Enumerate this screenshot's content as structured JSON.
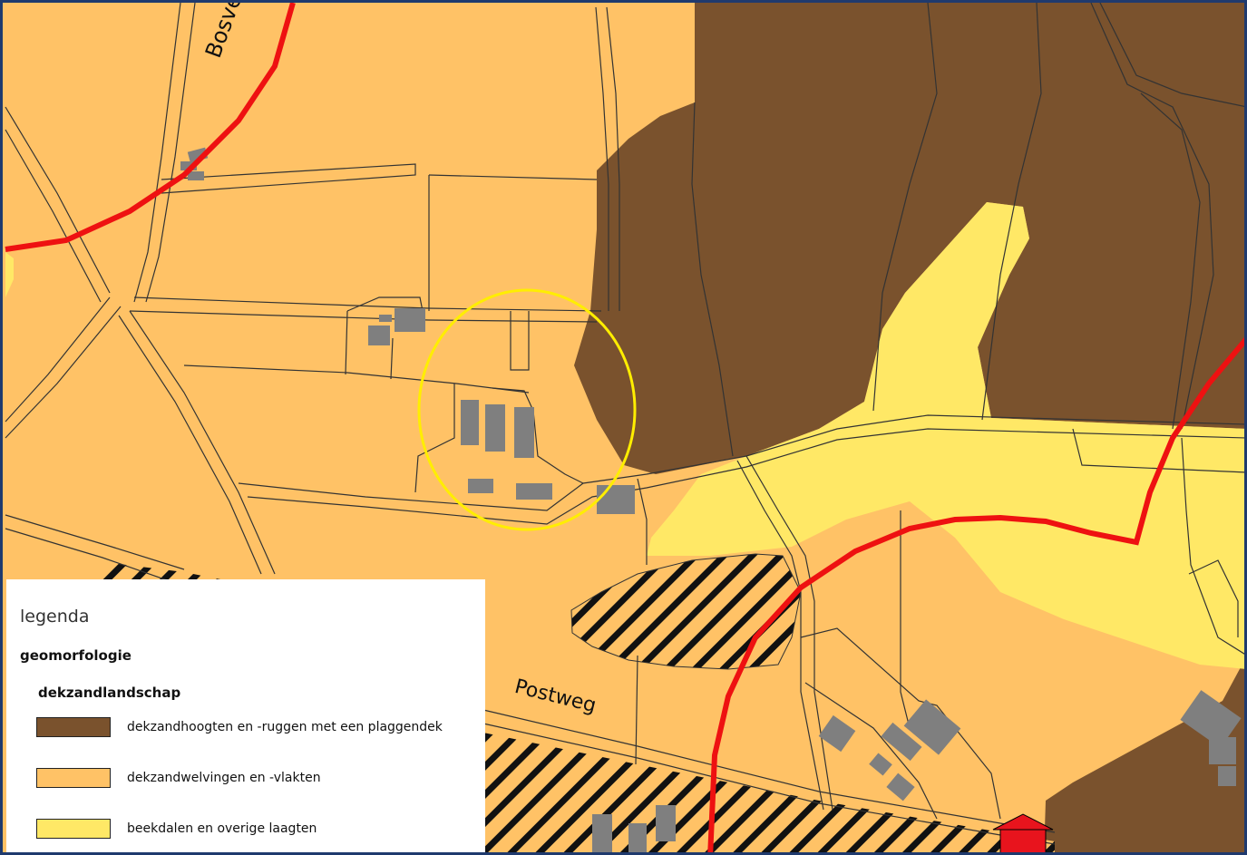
{
  "map": {
    "streets": {
      "bosvenweg": "Bosvenwe",
      "postweg": "Postweg"
    },
    "colors": {
      "dekzandhoogten": "#7a522d",
      "dekzandwelvingen": "#ffc266",
      "beekdalen": "#ffe866",
      "radius_line": "#ee1111",
      "highlight_circle": "#ffee00",
      "building": "#7f7f7f",
      "marker": "#e8141d"
    }
  },
  "legend": {
    "title": "legenda",
    "section": "geomorfologie",
    "subsection": "dekzandlandschap",
    "items": [
      {
        "label": "dekzandhoogten en -ruggen met een plaggendek",
        "color": "#7a522d"
      },
      {
        "label": "dekzandwelvingen en -vlakten",
        "color": "#ffc266"
      },
      {
        "label": "beekdalen en overige laagten",
        "color": "#ffe866"
      }
    ]
  }
}
